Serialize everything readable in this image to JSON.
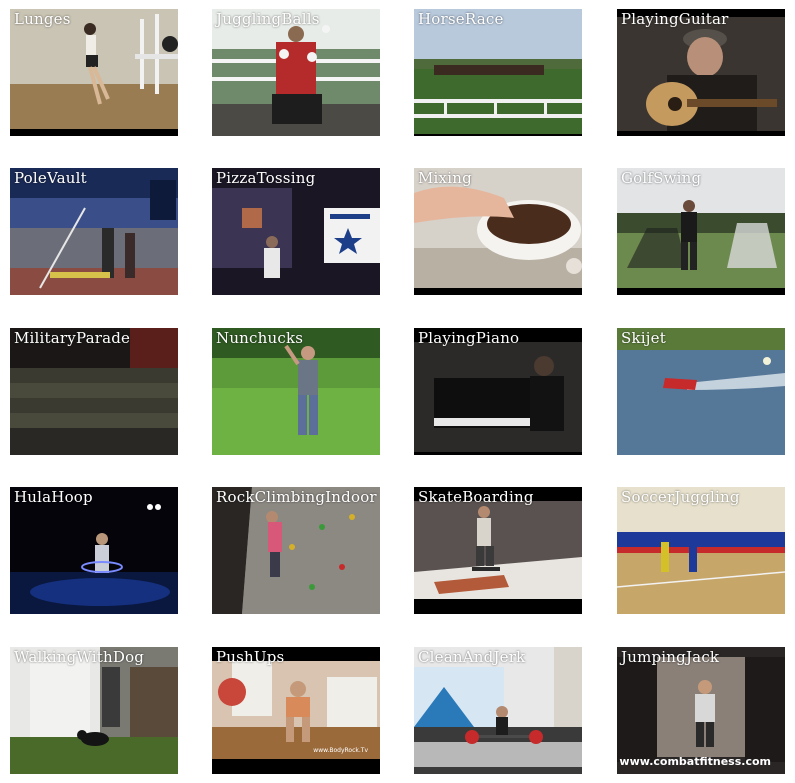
{
  "tiles": [
    {
      "label": "Lunges"
    },
    {
      "label": "JugglingBalls"
    },
    {
      "label": "HorseRace"
    },
    {
      "label": "PlayingGuitar"
    },
    {
      "label": "PoleVault"
    },
    {
      "label": "PizzaTossing"
    },
    {
      "label": "Mixing"
    },
    {
      "label": "GolfSwing"
    },
    {
      "label": "MilitaryParade"
    },
    {
      "label": "Nunchucks"
    },
    {
      "label": "PlayingPiano"
    },
    {
      "label": "Skijet"
    },
    {
      "label": "HulaHoop"
    },
    {
      "label": "RockClimbingIndoor"
    },
    {
      "label": "SkateBoarding"
    },
    {
      "label": "SoccerJuggling"
    },
    {
      "label": "WalkingWithDog"
    },
    {
      "label": "PushUps"
    },
    {
      "label": "CleanAndJerk"
    },
    {
      "label": "JumpingJack"
    }
  ],
  "watermarks": {
    "pushups": "www.BodyRock.Tv",
    "jumpingjack": "www.combatfitness.com"
  }
}
